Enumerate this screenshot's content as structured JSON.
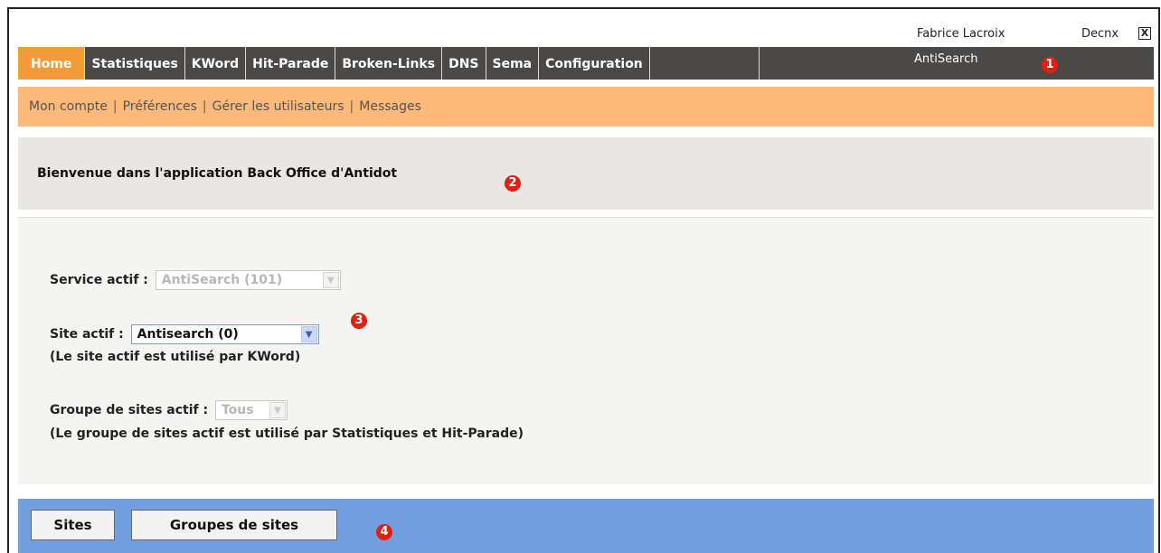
{
  "header": {
    "user_name": "Fabrice Lacroix",
    "logout_label": "Decnx",
    "close_symbol": "X",
    "service_name": "AntiSearch"
  },
  "nav": {
    "tabs": [
      {
        "label": "Home",
        "active": true
      },
      {
        "label": "Statistiques"
      },
      {
        "label": "KWord"
      },
      {
        "label": "Hit-Parade"
      },
      {
        "label": "Broken-Links"
      },
      {
        "label": "DNS"
      },
      {
        "label": "Sema"
      },
      {
        "label": "Configuration"
      }
    ]
  },
  "subnav": {
    "links": [
      "Mon compte",
      "Préférences",
      "Gérer les utilisateurs",
      "Messages"
    ],
    "separator": "|"
  },
  "welcome": {
    "message": "Bienvenue dans l'application Back Office d'Antidot"
  },
  "settings": {
    "service": {
      "label": "Service actif :",
      "value": "AntiSearch (101)"
    },
    "site": {
      "label": "Site actif :",
      "value": "Antisearch (0)",
      "note": "(Le site actif est utilisé par KWord)"
    },
    "group": {
      "label": "Groupe de sites actif :",
      "value": "Tous",
      "note": "(Le groupe de sites actif est utilisé par Statistiques et Hit-Parade)"
    }
  },
  "actions": {
    "sites_label": "Sites",
    "groups_label": "Groupes de sites"
  },
  "annotations": [
    "1",
    "2",
    "3",
    "4"
  ],
  "colors": {
    "active_tab": "#f39a3a",
    "navbar": "#4b4848",
    "subnav": "#fcb979",
    "welcome": "#e8e7e3",
    "actionbar": "#719fdf",
    "badge": "#e02010"
  }
}
